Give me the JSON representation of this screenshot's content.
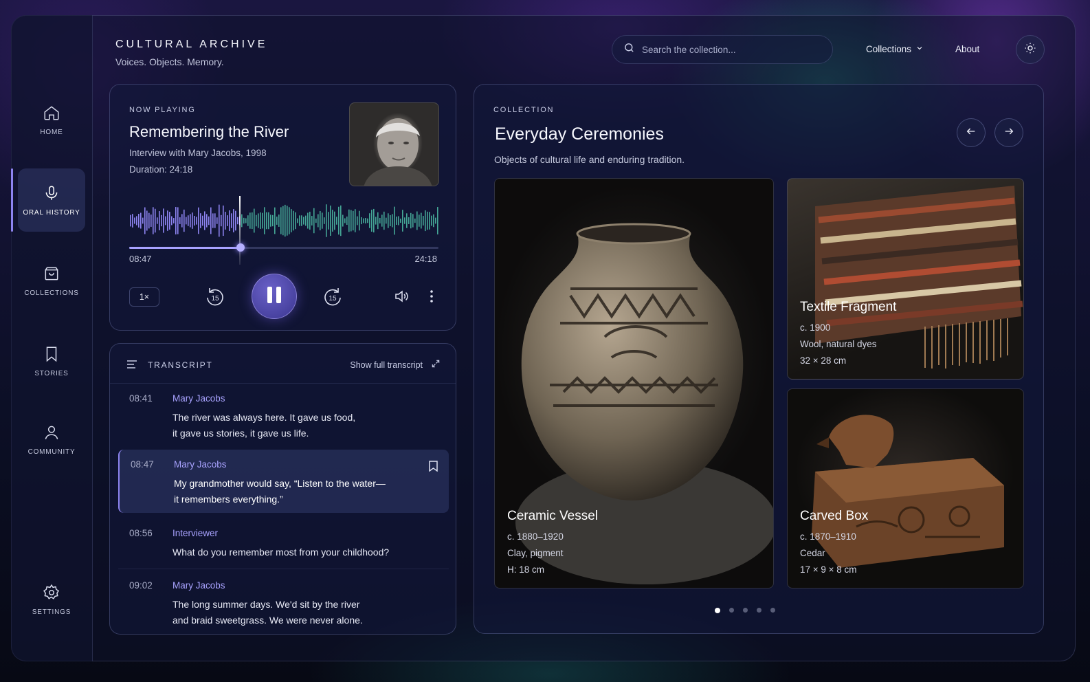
{
  "app": {
    "title": "CULTURAL ARCHIVE",
    "tagline": "Voices. Objects. Memory."
  },
  "header": {
    "search_placeholder": "Search the collection...",
    "nav_collections": "Collections",
    "nav_about": "About"
  },
  "sidebar": {
    "items": [
      {
        "label": "HOME",
        "icon": "home-icon"
      },
      {
        "label": "ORAL HISTORY",
        "icon": "microphone-icon",
        "active": true
      },
      {
        "label": "COLLECTIONS",
        "icon": "box-icon"
      },
      {
        "label": "STORIES",
        "icon": "bookmark-icon"
      },
      {
        "label": "COMMUNITY",
        "icon": "user-icon"
      },
      {
        "label": "SETTINGS",
        "icon": "gear-icon"
      }
    ]
  },
  "player": {
    "eyebrow": "NOW PLAYING",
    "title": "Remembering the River",
    "subtitle": "Interview with Mary Jacobs, 1998",
    "duration": "Duration: 24:18",
    "current_time": "08:47",
    "total_time": "24:18",
    "progress_fraction": 0.36,
    "speed": "1×",
    "skip_seconds": "15",
    "accent": "#8d84f0",
    "wave_colors": [
      "#8d84f0",
      "#4fc1a8"
    ]
  },
  "transcript": {
    "title": "TRANSCRIPT",
    "show_full": "Show full transcript",
    "entries": [
      {
        "time": "08:41",
        "speaker": "Mary Jacobs",
        "text": "The river was always here. It gave us food,\nit gave us stories, it gave us life."
      },
      {
        "time": "08:47",
        "speaker": "Mary Jacobs",
        "text": "My grandmother would say, “Listen to the water—\nit remembers everything.”",
        "highlighted": true
      },
      {
        "time": "08:56",
        "speaker": "Interviewer",
        "text": "What do you remember most from your childhood?"
      },
      {
        "time": "09:02",
        "speaker": "Mary Jacobs",
        "text": "The long summer days. We'd sit by the river\nand braid sweetgrass. We were never alone."
      }
    ]
  },
  "collection": {
    "eyebrow": "COLLECTION",
    "title": "Everyday Ceremonies",
    "description": "Objects of cultural life and enduring tradition.",
    "items": [
      {
        "name": "Ceramic Vessel",
        "date": "c. 1880–1920",
        "material": "Clay, pigment",
        "size": "H: 18 cm"
      },
      {
        "name": "Textile Fragment",
        "date": "c. 1900",
        "material": "Wool, natural dyes",
        "size": "32 × 28 cm"
      },
      {
        "name": "Carved Box",
        "date": "c. 1870–1910",
        "material": "Cedar",
        "size": "17 × 9 × 8 cm"
      }
    ],
    "pagination": {
      "pages": 5,
      "current": 1
    }
  }
}
